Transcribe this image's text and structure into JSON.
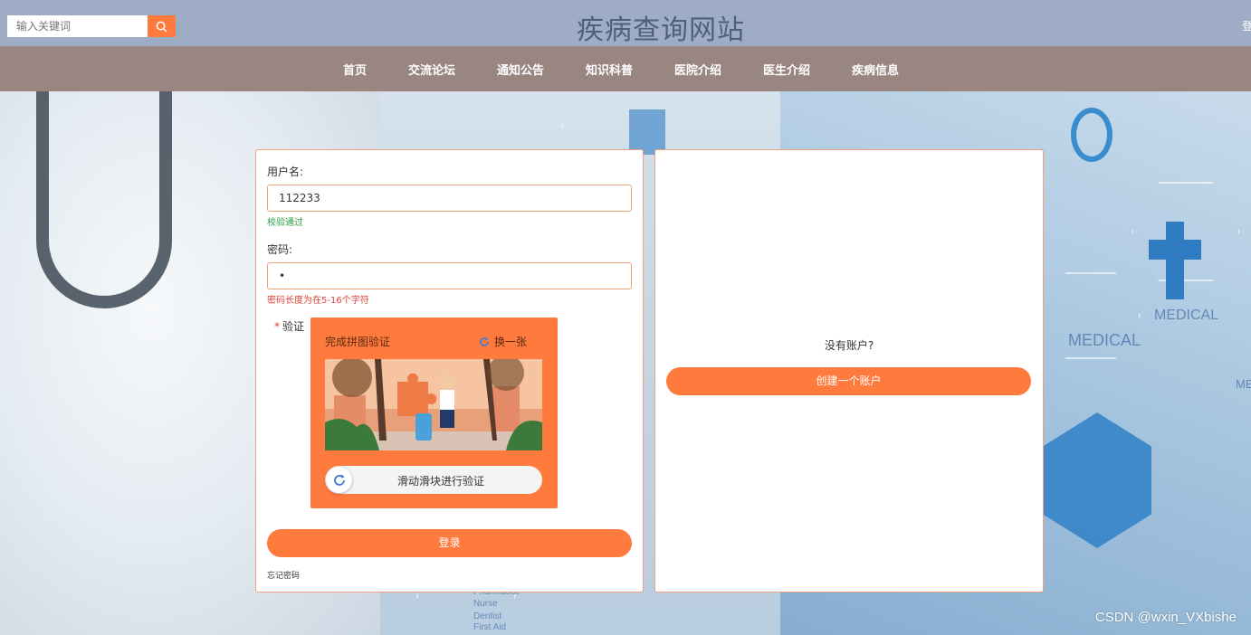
{
  "header": {
    "search_placeholder": "输入关键词",
    "site_title": "疾病查询网站",
    "login_link": "登"
  },
  "nav": {
    "items": [
      {
        "label": "首页"
      },
      {
        "label": "交流论坛"
      },
      {
        "label": "通知公告"
      },
      {
        "label": "知识科普"
      },
      {
        "label": "医院介绍"
      },
      {
        "label": "医生介绍"
      },
      {
        "label": "疾病信息"
      }
    ]
  },
  "login_form": {
    "username_label": "用户名:",
    "username_value": "112233",
    "username_hint": "校验通过",
    "password_label": "密码:",
    "password_value": "•",
    "password_hint": "密码长度为在5-16个字符",
    "verify_required_mark": "*",
    "verify_label": "验证",
    "captcha": {
      "title": "完成拼图验证",
      "refresh_label": "换一张",
      "slider_text": "滑动滑块进行验证"
    },
    "login_button": "登录",
    "forgot_password": "忘记密码"
  },
  "register_panel": {
    "prompt": "没有账户?",
    "create_button": "创建一个账户"
  },
  "background_text": {
    "medical_1": "MEDICAL",
    "medical_2": "MEDICAL",
    "medical_3": "ME",
    "list_1": "Pharmacist",
    "list_2": "Nurse",
    "list_3": "Dentist",
    "list_4": "First Aid"
  },
  "watermark": "CSDN @wxin_VXbishe",
  "colors": {
    "accent": "#ff7a3d",
    "header_bg": "#9eacc6",
    "nav_bg": "#9a8681",
    "success": "#2f9e44",
    "error": "#e0443a"
  }
}
